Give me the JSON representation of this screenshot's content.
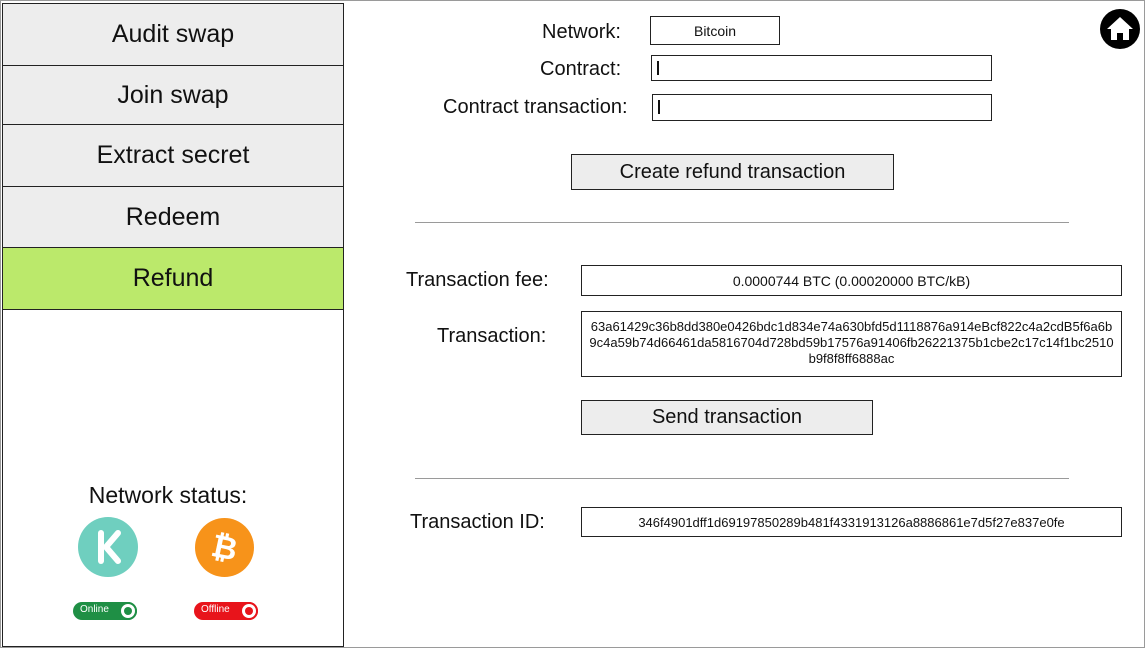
{
  "sidebar": {
    "items": [
      {
        "label": "Audit swap",
        "active": false
      },
      {
        "label": "Join swap",
        "active": false
      },
      {
        "label": "Extract secret",
        "active": false
      },
      {
        "label": "Redeem",
        "active": false
      },
      {
        "label": "Refund",
        "active": true
      }
    ],
    "network_status": {
      "title": "Network status:",
      "networks": [
        {
          "icon": "kaspa-icon",
          "status": "Online",
          "color": "#6fcfbf"
        },
        {
          "icon": "bitcoin-icon",
          "status": "Offline",
          "color": "#f7931a"
        }
      ]
    }
  },
  "form": {
    "network_label": "Network:",
    "network_value": "Bitcoin",
    "contract_label": "Contract:",
    "contract_value": "",
    "contract_tx_label": "Contract transaction:",
    "contract_tx_value": "",
    "create_refund_button": "Create refund transaction"
  },
  "result": {
    "fee_label": "Transaction fee:",
    "fee_value": "0.0000744 BTC (0.00020000 BTC/kB)",
    "tx_label": "Transaction:",
    "tx_value": "63a61429c36b8dd380e0426bdc1d834e74a630bfd5d1118876a914eBcf822c4a2cdB5f6a6b9c4a59b74d66461da5816704d728bd59b17576a91406fb26221375b1cbe2c17c14f1bc2510b9f8f8ff6888ac",
    "send_button": "Send transaction",
    "txid_label": "Transaction ID:",
    "txid_value": "346f4901dff1d69197850289b481f4331913126a8886861e7d5f27e837e0fe"
  },
  "colors": {
    "active_nav": "#bbe96b",
    "online": "#1f8f45",
    "offline": "#e8141b"
  }
}
